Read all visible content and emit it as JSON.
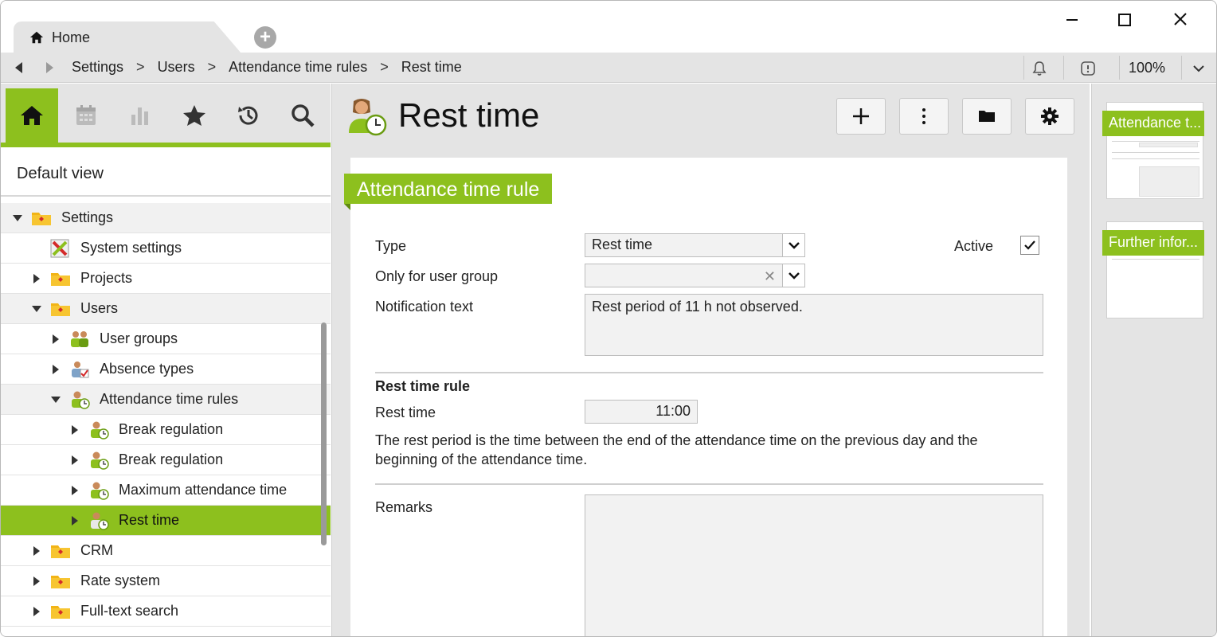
{
  "window": {
    "tab_label": "Home"
  },
  "navbar": {
    "breadcrumb": [
      "Settings",
      "Users",
      "Attendance time rules",
      "Rest time"
    ],
    "separator": ">",
    "zoom": "100%"
  },
  "sidebar": {
    "icons": [
      "home-icon",
      "calendar-icon",
      "chart-icon",
      "star-icon",
      "history-icon",
      "search-icon"
    ],
    "default_view": "Default view",
    "tree": [
      {
        "label": "Settings",
        "level": 0,
        "expanded": true,
        "icon": "folder-icon"
      },
      {
        "label": "System settings",
        "level": 1,
        "leaf": true,
        "icon": "settings-icon"
      },
      {
        "label": "Projects",
        "level": 1,
        "expanded": false,
        "icon": "folder-icon"
      },
      {
        "label": "Users",
        "level": 1,
        "expanded": true,
        "icon": "folder-icon"
      },
      {
        "label": "User groups",
        "level": 2,
        "expanded": false,
        "icon": "user-group-icon"
      },
      {
        "label": "Absence types",
        "level": 2,
        "expanded": false,
        "icon": "absence-icon"
      },
      {
        "label": "Attendance time rules",
        "level": 2,
        "expanded": true,
        "icon": "attendance-icon"
      },
      {
        "label": "Break regulation",
        "level": 3,
        "expanded": false,
        "icon": "attendance-icon"
      },
      {
        "label": "Break regulation",
        "level": 3,
        "expanded": false,
        "icon": "attendance-icon"
      },
      {
        "label": "Maximum attendance time",
        "level": 3,
        "expanded": false,
        "icon": "attendance-icon"
      },
      {
        "label": "Rest time",
        "level": 3,
        "expanded": false,
        "icon": "attendance-icon",
        "selected": true
      },
      {
        "label": "CRM",
        "level": 1,
        "expanded": false,
        "icon": "folder-icon"
      },
      {
        "label": "Rate system",
        "level": 1,
        "expanded": false,
        "icon": "folder-icon"
      },
      {
        "label": "Full-text search",
        "level": 1,
        "expanded": false,
        "icon": "folder-icon"
      }
    ]
  },
  "main": {
    "title": "Rest time",
    "toolbar": [
      "add-icon",
      "more-icon",
      "folder-icon",
      "gear-icon"
    ],
    "section_title": "Attendance time rule",
    "type_label": "Type",
    "type_value": "Rest time",
    "active_label": "Active",
    "active_checked": true,
    "user_group_label": "Only for user group",
    "user_group_value": "",
    "notification_label": "Notification text",
    "notification_value": "Rest period of 11 h not observed.",
    "rule_heading": "Rest time rule",
    "rest_time_label": "Rest time",
    "rest_time_value": "11:00",
    "description": "The rest period is the time between the end of the attendance time on the previous day and the beginning of the attendance time.",
    "remarks_label": "Remarks",
    "remarks_value": ""
  },
  "overview": {
    "thumbs": [
      "Attendance t...",
      "Further infor..."
    ]
  },
  "colors": {
    "accent": "#8dc01e",
    "panel_bg": "#e4e4e4"
  }
}
